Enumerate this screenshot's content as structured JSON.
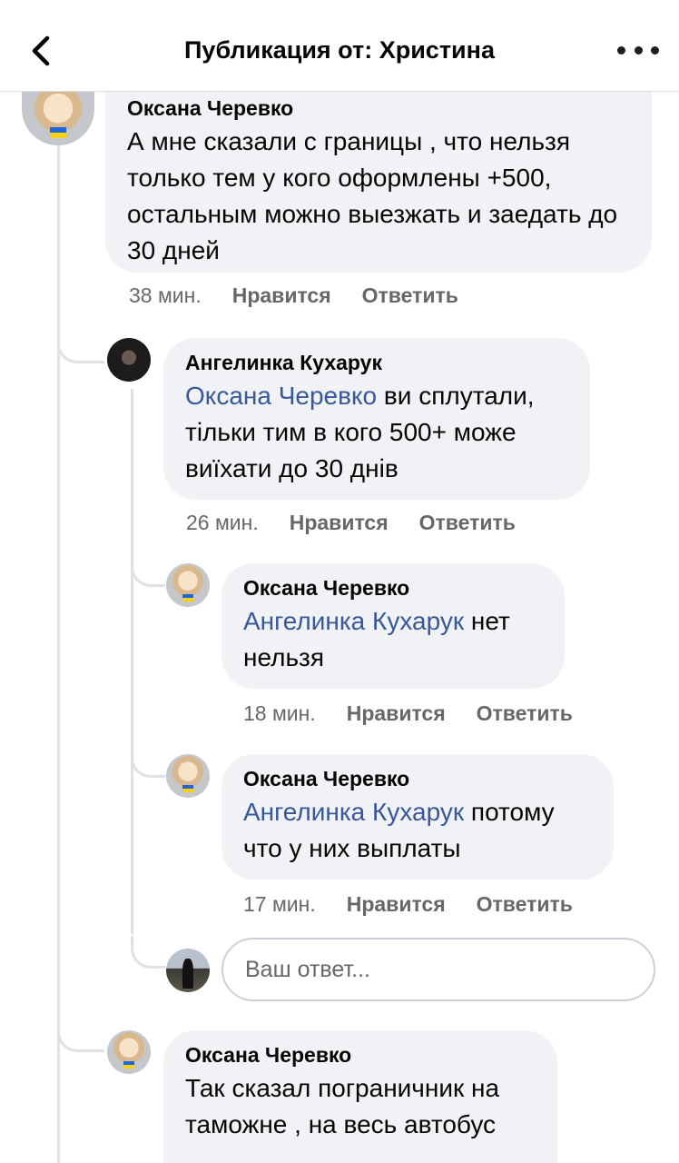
{
  "header": {
    "title": "Публикация от: Христина",
    "back_icon": "chevron-left-icon",
    "more_icon": "more-horizontal-icon"
  },
  "comments": [
    {
      "author": "Оксана Черевко",
      "mention": "",
      "text": "А мне сказали с границы , что нельзя только тем у кого оформлены +500, остальным можно выезжать и заедать до 30 дней",
      "time": "38 мин.",
      "like": "Нравится",
      "reply": "Ответить"
    },
    {
      "author": "Ангелинка Кухарук",
      "mention": "Оксана Черевко",
      "text": " ви сплутали, тільки тим в кого 500+ може виїхати до 30 днів",
      "time": "26 мин.",
      "like": "Нравится",
      "reply": "Ответить"
    },
    {
      "author": "Оксана Черевко",
      "mention": "Ангелинка Кухарук",
      "text": " нет нельзя",
      "time": "18 мин.",
      "like": "Нравится",
      "reply": "Ответить"
    },
    {
      "author": "Оксана Черевко",
      "mention": "Ангелинка Кухарук",
      "text": " потому что у них выплаты",
      "time": "17 мин.",
      "like": "Нравится",
      "reply": "Ответить"
    },
    {
      "author": "Оксана Черевко",
      "mention": "",
      "text": "Так сказал пограничник на таможне , на весь автобус"
    }
  ],
  "reply_box": {
    "placeholder": "Ваш ответ..."
  }
}
